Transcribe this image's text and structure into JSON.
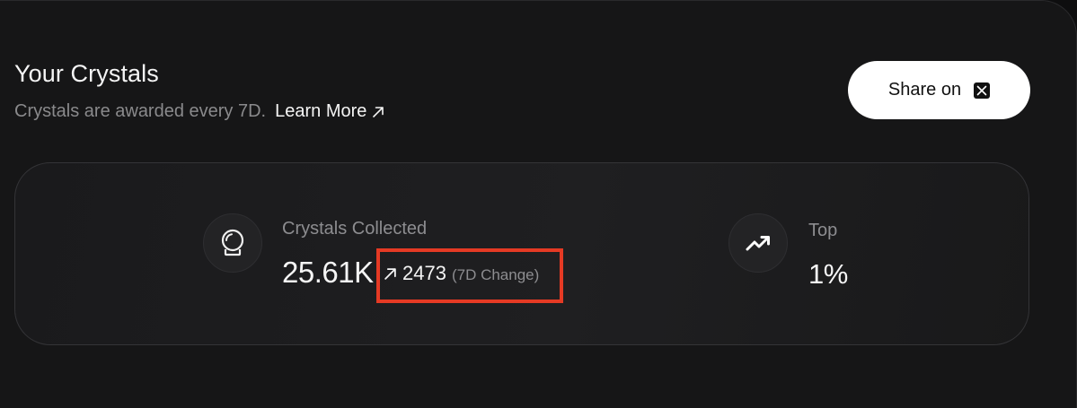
{
  "header": {
    "title": "Your Crystals",
    "subtitle": "Crystals are awarded every 7D.",
    "learn_more_label": "Learn More",
    "share_label": "Share on"
  },
  "stats": {
    "collected": {
      "label": "Crystals Collected",
      "value": "25.61K",
      "change_value": "2473",
      "change_label": "(7D Change)",
      "icon": "crystal-ball-icon"
    },
    "rank": {
      "label": "Top",
      "value": "1%",
      "icon": "trending-up-icon"
    }
  },
  "colors": {
    "background": "#161617",
    "highlight": "#e53a24",
    "button_bg": "#ffffff"
  }
}
